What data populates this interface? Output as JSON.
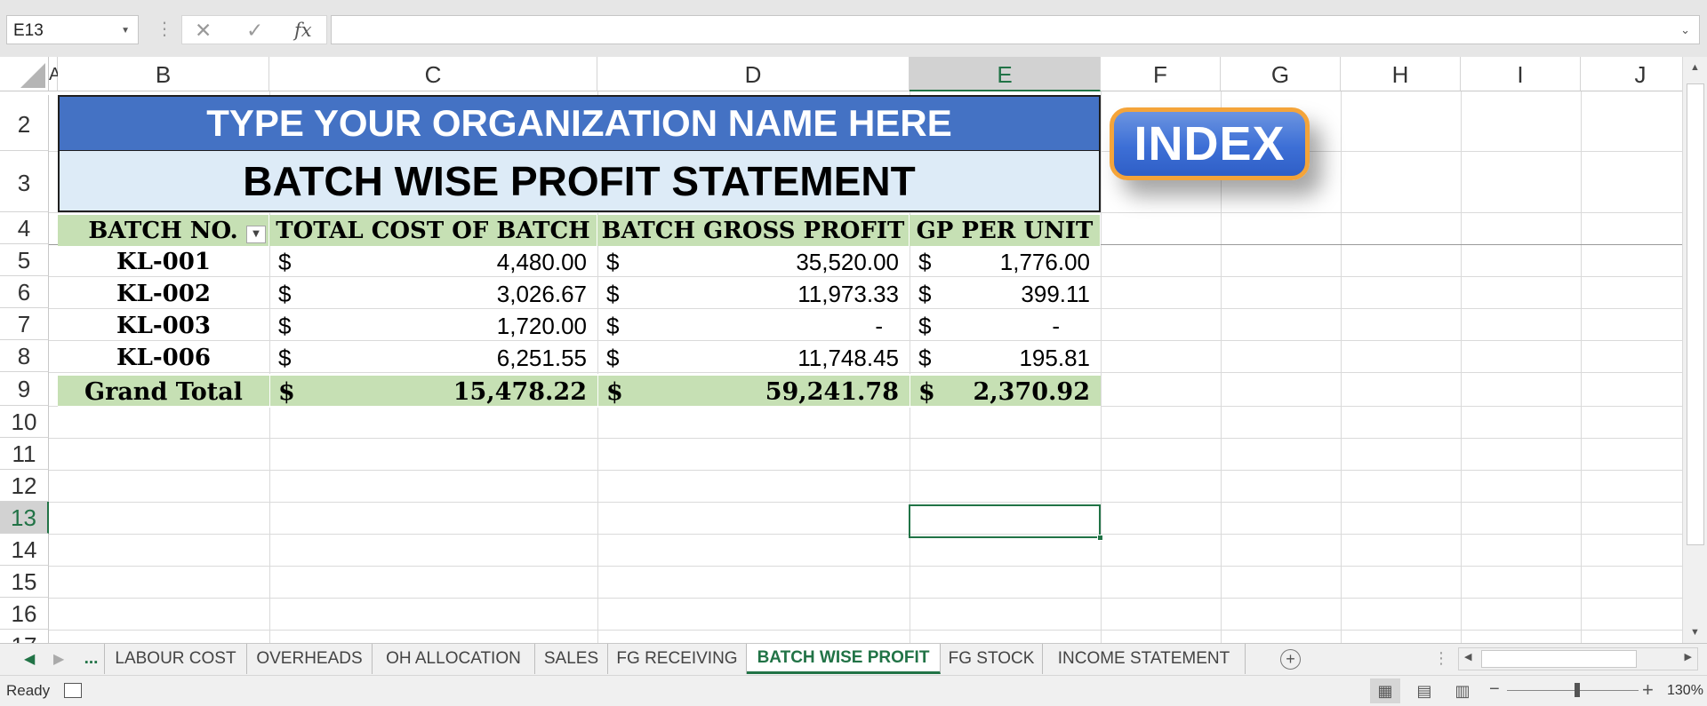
{
  "formula_bar": {
    "name_box": "E13",
    "cancel_icon": "✕",
    "enter_icon": "✓",
    "function_icon": "fx",
    "formula": ""
  },
  "columns": [
    "A",
    "B",
    "C",
    "D",
    "E",
    "F",
    "G",
    "H",
    "I",
    "J"
  ],
  "selected_column": "E",
  "rows": [
    "2",
    "3",
    "4",
    "5",
    "6",
    "7",
    "8",
    "9",
    "10",
    "11",
    "12",
    "13",
    "14",
    "15",
    "16",
    "17"
  ],
  "selected_row": "13",
  "sheet": {
    "org_name": "TYPE YOUR ORGANIZATION NAME HERE",
    "statement_title": "BATCH WISE PROFIT STATEMENT",
    "headers": [
      "BATCH NO.",
      "TOTAL COST OF BATCH",
      "BATCH GROSS PROFIT",
      "GP PER UNIT"
    ],
    "currency": "$",
    "data_rows": [
      {
        "batch": "KL-001",
        "cost": "4,480.00",
        "gross_profit": "35,520.00",
        "gp_per_unit": "1,776.00"
      },
      {
        "batch": "KL-002",
        "cost": "3,026.67",
        "gross_profit": "11,973.33",
        "gp_per_unit": "399.11"
      },
      {
        "batch": "KL-003",
        "cost": "1,720.00",
        "gross_profit": "-",
        "gp_per_unit": "-"
      },
      {
        "batch": "KL-006",
        "cost": "6,251.55",
        "gross_profit": "11,748.45",
        "gp_per_unit": "195.81"
      }
    ],
    "grand_total": {
      "label": "Grand Total",
      "cost": "15,478.22",
      "gross_profit": "59,241.78",
      "gp_per_unit": "2,370.92"
    },
    "index_button": "INDEX"
  },
  "tabs": {
    "more": "...",
    "items": [
      "LABOUR COST",
      "OVERHEADS",
      "OH ALLOCATION",
      "SALES",
      "FG RECEIVING",
      "BATCH WISE PROFIT",
      "FG STOCK",
      "INCOME STATEMENT"
    ],
    "active": "BATCH WISE PROFIT",
    "add_sheet": "+"
  },
  "status": {
    "ready": "Ready",
    "zoom": "130%",
    "zoom_minus": "−",
    "zoom_plus": "+"
  },
  "colors": {
    "excel_green": "#217346",
    "org_banner": "#4472c4",
    "title_banner": "#ddebf7",
    "header_fill": "#c6e0b4",
    "index_border": "#f4a43a"
  }
}
